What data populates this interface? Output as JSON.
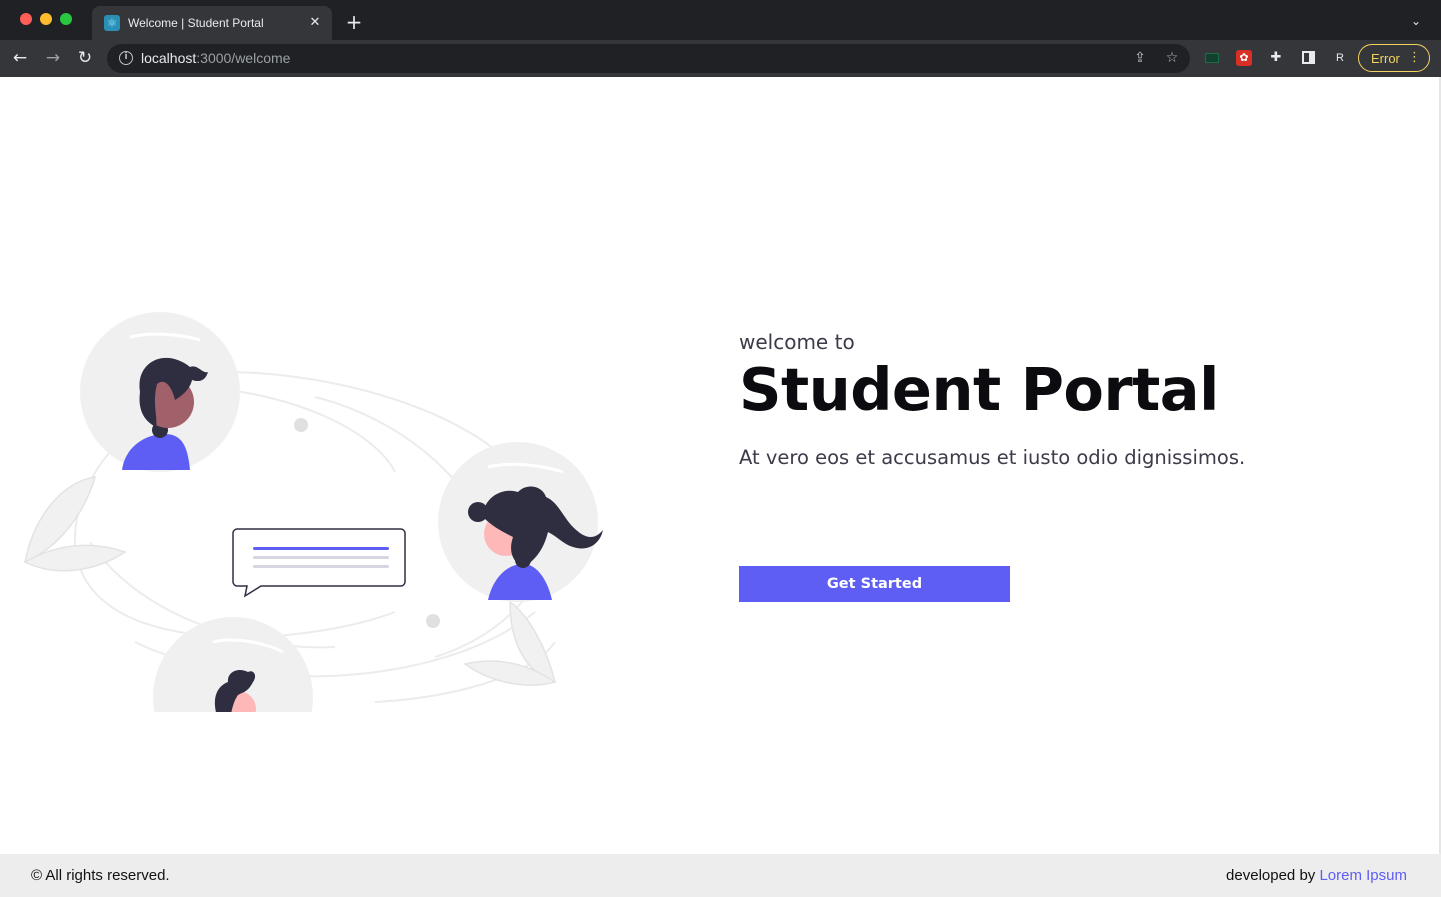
{
  "browser": {
    "tab_title": "Welcome | Student Portal",
    "tab_favicon": "react-icon",
    "close_glyph": "✕",
    "new_tab_glyph": "+",
    "tab_menu_glyph": "⌄",
    "back_glyph": "←",
    "forward_glyph": "→",
    "reload_glyph": "↻",
    "url_host": "localhost",
    "url_path": ":3000/welcome",
    "share_glyph": "⇪",
    "star_glyph": "☆",
    "profile_initial": "R",
    "error_label": "Error",
    "menu_glyph": "⋮"
  },
  "hero": {
    "eyebrow": "welcome to",
    "title": "Student Portal",
    "tagline": "At vero eos et accusamus et iusto odio dignissimos.",
    "cta_label": "Get Started"
  },
  "footer": {
    "copyright": "© All rights reserved.",
    "credit_prefix": "developed by ",
    "credit_link": "Lorem Ipsum"
  },
  "colors": {
    "accent": "#5e5ef4",
    "avatar_bg": "#f0f0f0",
    "hair": "#2f2e41",
    "skin_light": "#ffb8b8",
    "skin_dark": "#a0616a",
    "dot_pink": "#f4587a",
    "footer_bg": "#ededed"
  }
}
